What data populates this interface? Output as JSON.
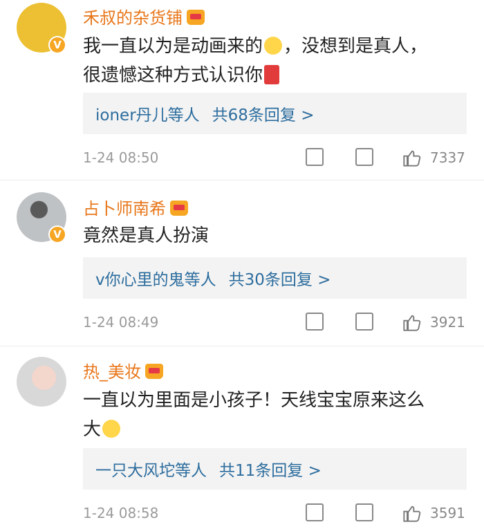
{
  "comments": [
    {
      "username": "禾叔的杂货铺",
      "text_line1": "我一直以为是动画来的",
      "text_line1b": "，没想到是真人，",
      "text_line2": "很遗憾这种方式认识你",
      "replies_users": "ioner丹儿等人",
      "replies_count": "共68条回复 >",
      "time": "1-24 08:50",
      "likes": "7337"
    },
    {
      "username": "占卜师南希",
      "text_line1": "竟然是真人扮演",
      "replies_users": "v你心里的鬼等人",
      "replies_count": "共30条回复 >",
      "time": "1-24 08:49",
      "likes": "3921"
    },
    {
      "username": "热_美妆",
      "text_line1": "一直以为里面是小孩子！天线宝宝原来这么",
      "text_line2": "大",
      "replies_users": "一只大风坨等人",
      "replies_count": "共11条回复 >",
      "time": "1-24 08:58",
      "likes": "3591"
    }
  ],
  "badges": {
    "verified": "V"
  },
  "icons": {
    "share": "share-icon",
    "comment": "comment-icon",
    "like": "thumbs-up-icon",
    "crown": "crown-icon",
    "emoji": "laughing-tears-emoji",
    "candle": "candle-emoji"
  },
  "colors": {
    "username": "#e8771b",
    "reply_link": "#2d6d9e",
    "reply_bg": "#f3f3f3",
    "meta": "#9a9a9a"
  }
}
